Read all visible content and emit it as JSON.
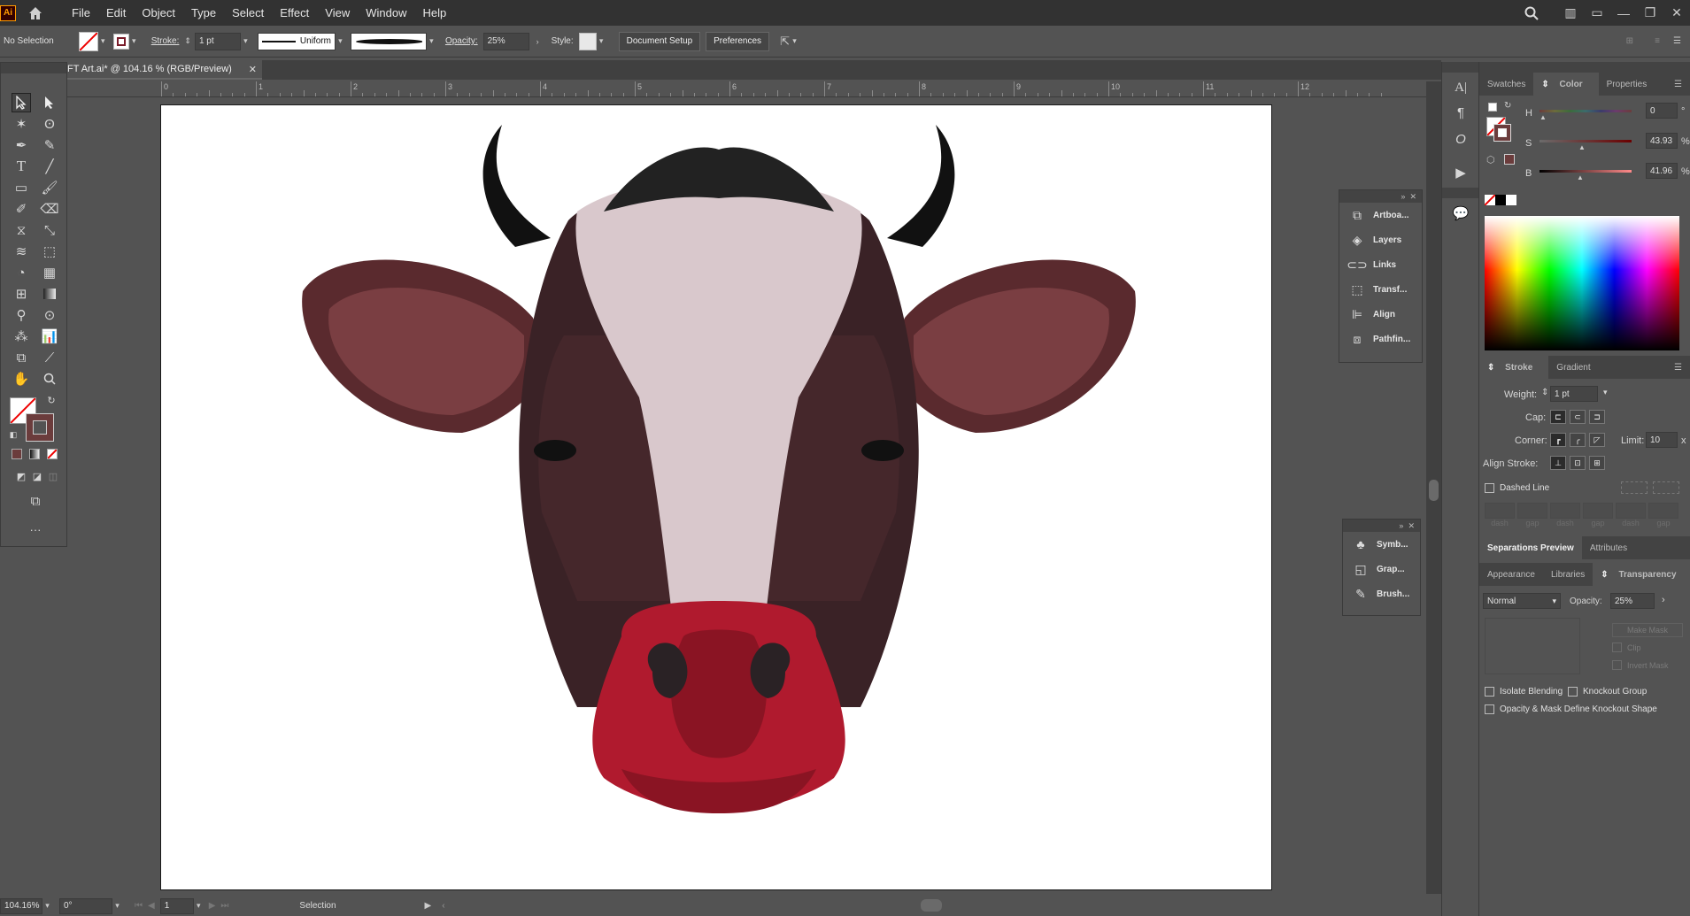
{
  "menubar": {
    "logo": "Ai",
    "items": [
      "File",
      "Edit",
      "Object",
      "Type",
      "Select",
      "Effect",
      "View",
      "Window",
      "Help"
    ]
  },
  "control": {
    "selection": "No Selection",
    "stroke_label": "Stroke:",
    "stroke_weight": "1 pt",
    "profile": "Uniform",
    "opacity_label": "Opacity:",
    "opacity_value": "25%",
    "style_label": "Style:",
    "doc_setup": "Document Setup",
    "preferences": "Preferences"
  },
  "document": {
    "tab_title": "FT Art.ai* @ 104.16 % (RGB/Preview)"
  },
  "ruler": {
    "labels": [
      "0",
      "1",
      "2",
      "3",
      "4",
      "5",
      "6",
      "7",
      "8",
      "9",
      "10",
      "11",
      "12"
    ]
  },
  "status": {
    "zoom": "104.16%",
    "rotation": "0°",
    "artboard": "1",
    "tool": "Selection"
  },
  "float_panel_1": {
    "items": [
      {
        "label": "Artboa...",
        "icon": "artboards-icon"
      },
      {
        "label": "Layers",
        "icon": "layers-icon"
      },
      {
        "label": "Links",
        "icon": "links-icon"
      },
      {
        "label": "Transf...",
        "icon": "transform-icon"
      },
      {
        "label": "Align",
        "icon": "align-icon"
      },
      {
        "label": "Pathfin...",
        "icon": "pathfinder-icon"
      }
    ]
  },
  "float_panel_2": {
    "items": [
      {
        "label": "Symb...",
        "icon": "symbols-icon"
      },
      {
        "label": "Grap...",
        "icon": "graphic-styles-icon"
      },
      {
        "label": "Brush...",
        "icon": "brushes-icon"
      }
    ]
  },
  "color_panel": {
    "tabs": [
      "Swatches",
      "Color",
      "Properties"
    ],
    "active_tab": "Color",
    "h_label": "H",
    "h_value": "0",
    "s_label": "S",
    "s_value": "43.93",
    "b_label": "B",
    "b_value": "41.96",
    "percent": "%",
    "degree": "°",
    "fill_color": "#6b3c3c"
  },
  "stroke_panel": {
    "tabs": [
      "Stroke",
      "Gradient"
    ],
    "weight_label": "Weight:",
    "weight_value": "1 pt",
    "cap_label": "Cap:",
    "corner_label": "Corner:",
    "limit_label": "Limit:",
    "limit_value": "10",
    "limit_unit": "x",
    "align_label": "Align Stroke:",
    "dashed_label": "Dashed Line",
    "dash_labels": [
      "dash",
      "gap",
      "dash",
      "gap",
      "dash",
      "gap"
    ]
  },
  "sep_panel": {
    "tabs": [
      "Separations Preview",
      "Attributes"
    ]
  },
  "transparency_panel": {
    "tabs": [
      "Appearance",
      "Libraries",
      "Transparency"
    ],
    "blend_mode": "Normal",
    "opacity_label": "Opacity:",
    "opacity_value": "25%",
    "make_mask": "Make Mask",
    "clip": "Clip",
    "invert_mask": "Invert Mask",
    "isolate": "Isolate Blending",
    "knockout": "Knockout Group",
    "opacity_mask": "Opacity & Mask Define Knockout Shape"
  },
  "colors": {
    "nose": "#b01a2e",
    "nose_dark": "#8a1423",
    "face_white": "#d9c8cc",
    "face_dark": "#3a2226",
    "ear": "#6b3a3c",
    "horn": "#111111"
  }
}
